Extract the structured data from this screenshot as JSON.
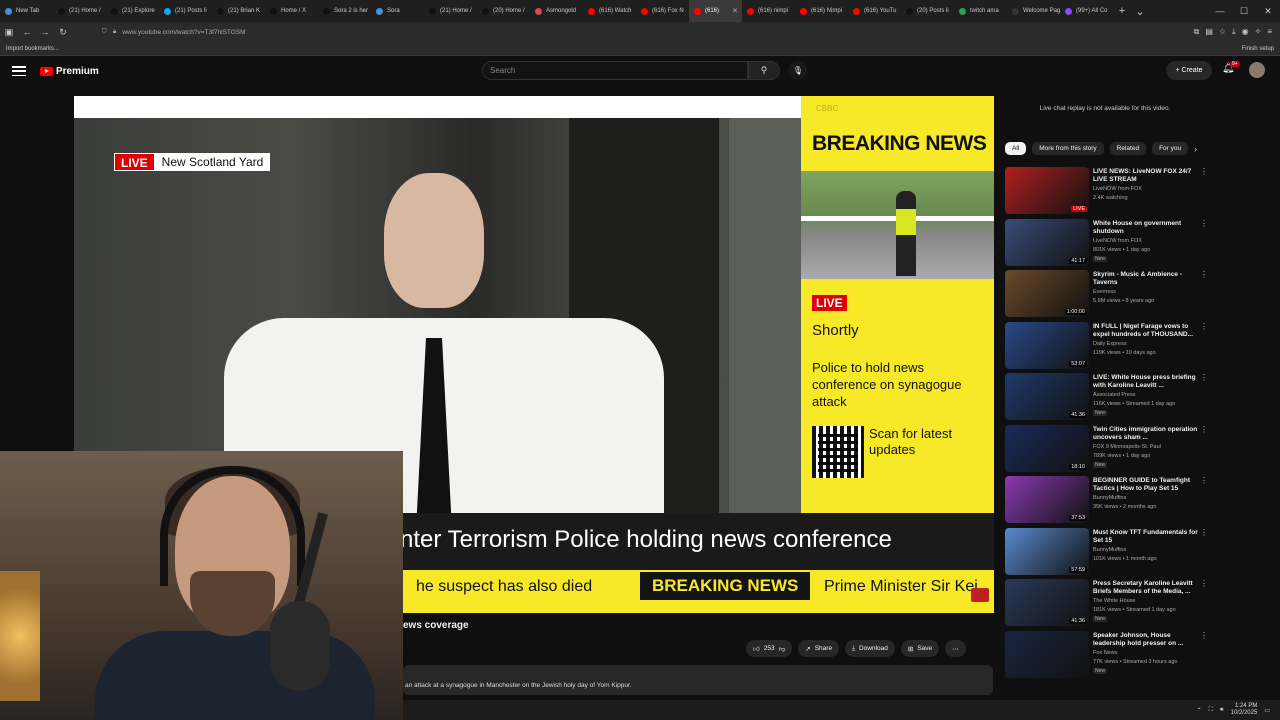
{
  "browser": {
    "tabs": [
      {
        "label": "New Tab",
        "color": "#4a90d9"
      },
      {
        "label": "(21) Home /",
        "color": "#111111"
      },
      {
        "label": "(21) Explore",
        "color": "#111111"
      },
      {
        "label": "(21) Posts li",
        "color": "#1da1f2"
      },
      {
        "label": "(21) Brian K",
        "color": "#111111"
      },
      {
        "label": "Home / X",
        "color": "#111111"
      },
      {
        "label": "Sora 2 is her",
        "color": "#111111"
      },
      {
        "label": "Sora",
        "color": "#4a90d9"
      },
      {
        "label": "(21) Home /",
        "color": "#111111"
      },
      {
        "label": "(20) Home /",
        "color": "#111111"
      },
      {
        "label": "Asmongold",
        "color": "#d94a4a"
      },
      {
        "label": "(616) Watch",
        "color": "#ff0000"
      },
      {
        "label": "(616) Fox N",
        "color": "#ff0000"
      },
      {
        "label": "(616)",
        "color": "#ff0000",
        "active": true
      },
      {
        "label": "(616) nimpi",
        "color": "#ff0000"
      },
      {
        "label": "(616) Nimpi",
        "color": "#ff0000"
      },
      {
        "label": "(616) YouTu",
        "color": "#ff0000"
      },
      {
        "label": "(20) Posts li",
        "color": "#111111"
      },
      {
        "label": "twitch ama",
        "color": "#2ea043"
      },
      {
        "label": "Welcome Page",
        "color": "#333333"
      },
      {
        "label": "(99+) All Co",
        "color": "#9146ff"
      }
    ],
    "url": "www.youtube.com/watch?v=T3f7hlSTOSM",
    "bookmarks_import": "Import bookmarks...",
    "finish_setup": "Finish setup"
  },
  "youtube": {
    "logo_text": "Premium",
    "search_placeholder": "Search",
    "create_label": "Create",
    "notifications_badge": "9+"
  },
  "player": {
    "live_label": "LIVE",
    "location_label": "New Scotland Yard",
    "panel": {
      "channel_tag": "CBBC",
      "breaking_news": "BREAKING NEWS",
      "live_box": "LIVE",
      "shortly": "Shortly",
      "headline": "Police to hold news conference on synagogue attack",
      "scan_text": "Scan for latest updates"
    },
    "lower_third": "nter Terrorism Police holding news conference",
    "ticker": {
      "left": "he suspect has also died",
      "breaking": "BREAKING NEWS",
      "right": "Prime Minister Sir Kei"
    }
  },
  "below_video": {
    "title_fragment": "ews coverage",
    "likes": "253",
    "share_label": "Share",
    "download_label": "Download",
    "save_label": "Save",
    "description": "an attack at a synagogue in Manchester on the Jewish holy day of Yom Kippur."
  },
  "sidebar": {
    "chat_note": "Live chat replay is not available for this video.",
    "chips": [
      "All",
      "More from this story",
      "Related",
      "For you"
    ],
    "videos": [
      {
        "title": "LIVE NEWS: LiveNOW FOX 24/7 LIVE STREAM",
        "channel": "LiveNOW from FOX",
        "meta": "2.4K watching",
        "duration": "LIVE",
        "badge": "",
        "thumb": "#b02020"
      },
      {
        "title": "White House on government shutdown",
        "channel": "LiveNOW from FOX",
        "meta": "801K views • 1 day ago",
        "duration": "41:17",
        "badge": "New",
        "thumb": "#3a4c7a"
      },
      {
        "title": "Skyrim - Music & Ambience - Taverns",
        "channel": "Everness",
        "meta": "5.9M views • 8 years ago",
        "duration": "1:00:00",
        "badge": "",
        "thumb": "#6b4a2a"
      },
      {
        "title": "IN FULL | Nigel Farage vows to expel hundreds of THOUSAND...",
        "channel": "Daily Express",
        "meta": "119K views • 10 days ago",
        "duration": "53:07",
        "badge": "",
        "thumb": "#2a4a8a"
      },
      {
        "title": "LIVE: White House press briefing with Karoline Leavitt ...",
        "channel": "Associated Press",
        "meta": "116K views • Streamed 1 day ago",
        "duration": "41:36",
        "badge": "New",
        "thumb": "#1f3a6a"
      },
      {
        "title": "Twin Cities immigration operation uncovers sham ...",
        "channel": "FOX 9 Minneapolis-St. Paul",
        "meta": "789K views • 1 day ago",
        "duration": "18:10",
        "badge": "New",
        "thumb": "#1a2a5a"
      },
      {
        "title": "BEGINNER GUIDE to Teamfight Tactics | How to Play Set 15",
        "channel": "BunnyMuffins",
        "meta": "35K views • 2 months ago",
        "duration": "37:53",
        "badge": "",
        "thumb": "#8a3ab0"
      },
      {
        "title": "Must Know TFT Fundamentals for Set 15",
        "channel": "BunnyMuffins",
        "meta": "101K views • 1 month ago",
        "duration": "57:59",
        "badge": "",
        "thumb": "#5a8ad0"
      },
      {
        "title": "Press Secretary Karoline Leavitt Briefs Members of the Media, ...",
        "channel": "The White House",
        "meta": "181K views • Streamed 1 day ago",
        "duration": "41:36",
        "badge": "New",
        "thumb": "#2a3a5a"
      },
      {
        "title": "Speaker Johnson, House leadership hold presser on ...",
        "channel": "Fox News",
        "meta": "77K views • Streamed 3 hours ago",
        "duration": "",
        "badge": "New",
        "thumb": "#1a2540"
      }
    ]
  },
  "taskbar": {
    "time": "1:24 PM",
    "date": "10/2/2025"
  }
}
